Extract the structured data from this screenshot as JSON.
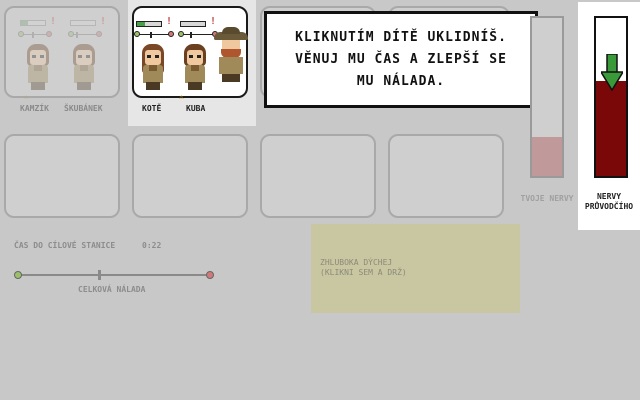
{
  "dialog": {
    "text": "KLIKNUTÍM DÍTĚ UKLIDNÍŠ.\nVĚNUJ MU ČAS A ZLEPŠÍ SE\nMU NÁLADA."
  },
  "passengers": {
    "slot1": {
      "names": [
        "KAMZÍK",
        "ŠKUBÁNEK"
      ],
      "mood_left": 0.5,
      "mood_right": 0.15
    },
    "slot2": {
      "names": [
        "KOTĚ",
        "KUBA"
      ],
      "mood_left": 0.45,
      "mood_right": 0.1
    }
  },
  "meters": {
    "your_nerves_label": "TVOJE NERVY",
    "your_nerves_level": 0.25,
    "driver_nerves_label": "NERVY\nPRŮVODČÍHO",
    "driver_nerves_level": 0.6,
    "colors": {
      "your_fill": "#c09a9a",
      "driver_fill": "#7a0808",
      "arrow": "#3a9a3a"
    }
  },
  "status": {
    "time_label": "ČAS DO CÍLOVÉ STANICE",
    "time_value": "0:22",
    "mood_label": "CELKOVÁ NÁLADA",
    "mood_position": 0.42
  },
  "breathe": {
    "line1": "ZHLUBOKA DÝCHEJ",
    "line2": "(KLIKNI SEM A DRŽ)"
  },
  "icons": {
    "warning": "⚠",
    "exclamation": "!"
  }
}
